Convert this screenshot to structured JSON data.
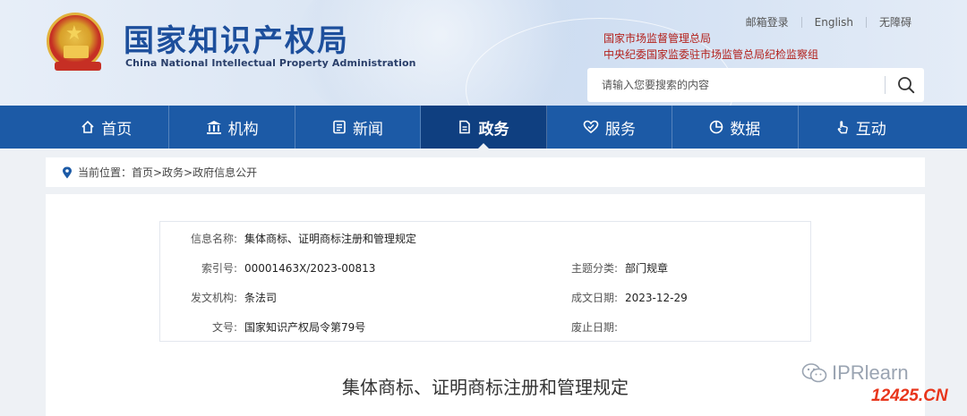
{
  "header": {
    "title_cn": "国家知识产权局",
    "title_en": "China National Intellectual Property Administration",
    "top_links": [
      "邮箱登录",
      "English",
      "无障碍"
    ],
    "affiliations": [
      "国家市场监督管理总局",
      "中央纪委国家监委驻市场监管总局纪检监察组"
    ]
  },
  "search": {
    "placeholder": "请输入您要搜索的内容"
  },
  "nav": {
    "items": [
      {
        "label": "首页",
        "icon": "home-icon"
      },
      {
        "label": "机构",
        "icon": "institution-icon"
      },
      {
        "label": "新闻",
        "icon": "news-icon"
      },
      {
        "label": "政务",
        "icon": "affairs-icon",
        "active": true
      },
      {
        "label": "服务",
        "icon": "service-icon"
      },
      {
        "label": "数据",
        "icon": "data-icon"
      },
      {
        "label": "互动",
        "icon": "interaction-icon"
      }
    ]
  },
  "breadcrumb": {
    "text": "当前位置：首页>政务>政府信息公开"
  },
  "info": {
    "name_label": "信息名称:",
    "name_value": "集体商标、证明商标注册和管理规定",
    "index_label": "索引号:",
    "index_value": "00001463X/2023-00813",
    "topic_label": "主题分类:",
    "topic_value": "部门规章",
    "issuer_label": "发文机构:",
    "issuer_value": "条法司",
    "date_label": "成文日期:",
    "date_value": "2023-12-29",
    "docno_label": "文号:",
    "docno_value": "国家知识产权局令第79号",
    "abolish_label": "废止日期:",
    "abolish_value": ""
  },
  "document": {
    "title": "集体商标、证明商标注册和管理规定"
  },
  "watermarks": {
    "wechat": "IPRlearn",
    "site": "12425.CN"
  },
  "colors": {
    "nav_bg": "#1c5aa6",
    "nav_active": "#0f3f80",
    "title_blue": "#1d4f9c",
    "affil_red": "#b3201b"
  }
}
